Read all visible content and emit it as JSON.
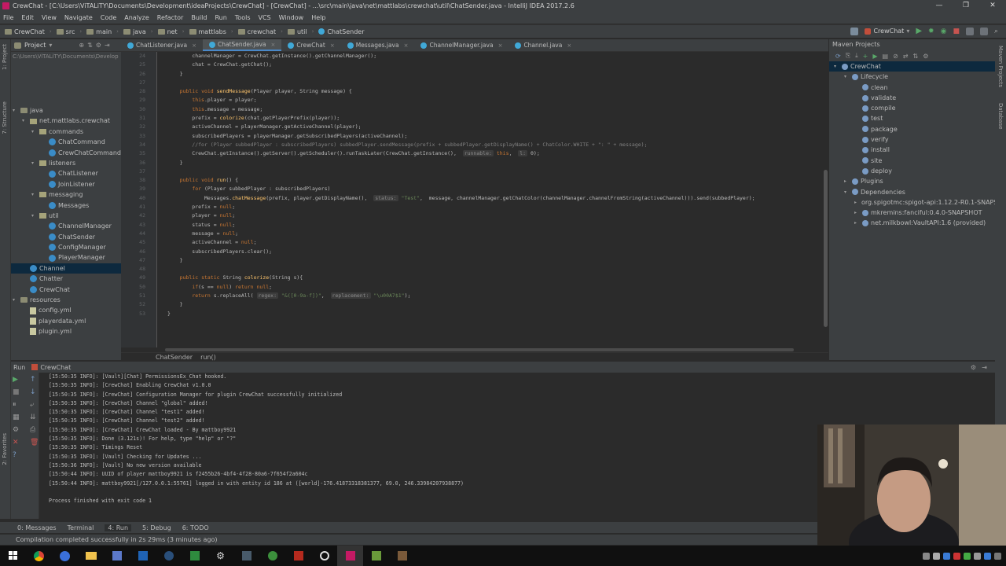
{
  "window": {
    "title": "CrewChat - [C:\\Users\\ViTALiTY\\Documents\\Development\\ideaProjects\\CrewChat] - [CrewChat] - ...\\src\\main\\java\\net\\mattlabs\\crewchat\\util\\ChatSender.java - IntelliJ IDEA 2017.2.6",
    "controls": [
      "—",
      "❐",
      "✕"
    ]
  },
  "menu": [
    "File",
    "Edit",
    "View",
    "Navigate",
    "Code",
    "Analyze",
    "Refactor",
    "Build",
    "Run",
    "Tools",
    "VCS",
    "Window",
    "Help"
  ],
  "breadcrumbs": [
    "CrewChat",
    "src",
    "main",
    "java",
    "net",
    "mattlabs",
    "crewchat",
    "util",
    "ChatSender"
  ],
  "run_config": "CrewChat",
  "project_panel": {
    "title": "Project",
    "path_hint": "C:\\Users\\ViTALiTY\\Documents\\Develop",
    "items": [
      {
        "label": "java",
        "indent": 0,
        "kind": "folder",
        "arrow": "▾"
      },
      {
        "label": "net.mattlabs.crewchat",
        "indent": 1,
        "kind": "pkg",
        "arrow": "▾"
      },
      {
        "label": "commands",
        "indent": 2,
        "kind": "pkg",
        "arrow": "▾"
      },
      {
        "label": "ChatCommand",
        "indent": 3,
        "kind": "cls",
        "arrow": ""
      },
      {
        "label": "CrewChatCommand",
        "indent": 3,
        "kind": "cls",
        "arrow": ""
      },
      {
        "label": "listeners",
        "indent": 2,
        "kind": "pkg",
        "arrow": "▾"
      },
      {
        "label": "ChatListener",
        "indent": 3,
        "kind": "cls",
        "arrow": ""
      },
      {
        "label": "JoinListener",
        "indent": 3,
        "kind": "cls",
        "arrow": ""
      },
      {
        "label": "messaging",
        "indent": 2,
        "kind": "pkg",
        "arrow": "▾"
      },
      {
        "label": "Messages",
        "indent": 3,
        "kind": "cls",
        "arrow": ""
      },
      {
        "label": "util",
        "indent": 2,
        "kind": "pkg",
        "arrow": "▾"
      },
      {
        "label": "ChannelManager",
        "indent": 3,
        "kind": "cls",
        "arrow": ""
      },
      {
        "label": "ChatSender",
        "indent": 3,
        "kind": "cls",
        "arrow": ""
      },
      {
        "label": "ConfigManager",
        "indent": 3,
        "kind": "cls",
        "arrow": ""
      },
      {
        "label": "PlayerManager",
        "indent": 3,
        "kind": "cls",
        "arrow": ""
      },
      {
        "label": "Channel",
        "indent": 1,
        "kind": "cls",
        "arrow": "",
        "selected": true
      },
      {
        "label": "Chatter",
        "indent": 1,
        "kind": "cls",
        "arrow": ""
      },
      {
        "label": "CrewChat",
        "indent": 1,
        "kind": "cls",
        "arrow": ""
      },
      {
        "label": "resources",
        "indent": 0,
        "kind": "folder",
        "arrow": "▾"
      },
      {
        "label": "config.yml",
        "indent": 1,
        "kind": "yml",
        "arrow": ""
      },
      {
        "label": "playerdata.yml",
        "indent": 1,
        "kind": "yml",
        "arrow": ""
      },
      {
        "label": "plugin.yml",
        "indent": 1,
        "kind": "yml",
        "arrow": ""
      }
    ]
  },
  "tabs": [
    {
      "label": "ChatListener.java",
      "active": false
    },
    {
      "label": "ChatSender.java",
      "active": true
    },
    {
      "label": "CrewChat",
      "active": false
    },
    {
      "label": "Messages.java",
      "active": false
    },
    {
      "label": "ChannelManager.java",
      "active": false
    },
    {
      "label": "Channel.java",
      "active": false
    }
  ],
  "gutter_lines": [
    "24",
    "25",
    "26",
    "27",
    "28",
    "29",
    "30",
    "31",
    "32",
    "33",
    "34",
    "35",
    "36",
    "37",
    "38",
    "39",
    "40",
    "41",
    "42",
    "43",
    "44",
    "45",
    "46",
    "47",
    "48",
    "49",
    "50",
    "51",
    "52",
    "53"
  ],
  "code_lines": [
    "        channelManager = CrewChat.getInstance().getChannelManager();",
    "        chat = CrewChat.getChat();",
    "    }",
    "",
    "    public void sendMessage(Player player, String message) {",
    "        this.player = player;",
    "        this.message = message;",
    "        prefix = colorize(chat.getPlayerPrefix(player));",
    "        activeChannel = playerManager.getActiveChannel(player);",
    "        subscribedPlayers = playerManager.getSubscribedPlayers(activeChannel);",
    "        //for (Player subbedPlayer : subscribedPlayers) subbedPlayer.sendMessage(prefix + subbedPlayer.getDisplayName() + ChatColor.WHITE + \": \" + message);",
    "        CrewChat.getInstance().getServer().getScheduler().runTaskLater(CrewChat.getInstance(),  runnable: this,  l: 0);",
    "    }",
    "",
    "    public void run() {",
    "        for (Player subbedPlayer : subscribedPlayers)",
    "            Messages.chatMessage(prefix, player.getDisplayName(),  status: \"Test\",  message, channelManager.getChatColor(channelManager.channelFromString(activeChannel))).send(subbedPlayer);",
    "        prefix = null;",
    "        player = null;",
    "        status = null;",
    "        message = null;",
    "        activeChannel = null;",
    "        subscribedPlayers.clear();",
    "    }",
    "",
    "    public static String colorize(String s){",
    "        if(s == null) return null;",
    "        return s.replaceAll( regex: \"&([0-9a-f])\",  replacement: \"\\u00A7$1\");",
    "    }",
    "}"
  ],
  "editor_breadcrumb": [
    "ChatSender",
    "run()"
  ],
  "maven": {
    "title": "Maven Projects",
    "items": [
      {
        "label": "CrewChat",
        "indent": 0,
        "arrow": "▾",
        "selected": true
      },
      {
        "label": "Lifecycle",
        "indent": 1,
        "arrow": "▾"
      },
      {
        "label": "clean",
        "indent": 2,
        "arrow": ""
      },
      {
        "label": "validate",
        "indent": 2,
        "arrow": ""
      },
      {
        "label": "compile",
        "indent": 2,
        "arrow": ""
      },
      {
        "label": "test",
        "indent": 2,
        "arrow": ""
      },
      {
        "label": "package",
        "indent": 2,
        "arrow": ""
      },
      {
        "label": "verify",
        "indent": 2,
        "arrow": ""
      },
      {
        "label": "install",
        "indent": 2,
        "arrow": ""
      },
      {
        "label": "site",
        "indent": 2,
        "arrow": ""
      },
      {
        "label": "deploy",
        "indent": 2,
        "arrow": ""
      },
      {
        "label": "Plugins",
        "indent": 1,
        "arrow": "▸"
      },
      {
        "label": "Dependencies",
        "indent": 1,
        "arrow": "▾"
      },
      {
        "label": "org.spigotmc:spigot-api:1.12.2-R0.1-SNAPSH",
        "indent": 2,
        "arrow": "▸"
      },
      {
        "label": "mkremins:fanciful:0.4.0-SNAPSHOT",
        "indent": 2,
        "arrow": "▸"
      },
      {
        "label": "net.milkbowl:VaultAPI:1.6 (provided)",
        "indent": 2,
        "arrow": "▸"
      }
    ]
  },
  "run_panel": {
    "label": "Run",
    "config": "CrewChat",
    "lines": [
      "[15:50:35 INFO]: [Vault][Chat] PermissionsEx_Chat hooked.",
      "[15:50:35 INFO]: [CrewChat] Enabling CrewChat v1.0.0",
      "[15:50:35 INFO]: [CrewChat] Configuration Manager for plugin CrewChat successfully initialized",
      "[15:50:35 INFO]: [CrewChat] Channel \"global\" added!",
      "[15:50:35 INFO]: [CrewChat] Channel \"test1\" added!",
      "[15:50:35 INFO]: [CrewChat] Channel \"test2\" added!",
      "[15:50:35 INFO]: [CrewChat] CrewChat loaded - By mattboy9921",
      "[15:50:35 INFO]: Done (3.121s)! For help, type \"help\" or \"?\"",
      "[15:50:35 INFO]: Timings Reset",
      "[15:50:35 INFO]: [Vault] Checking for Updates ...",
      "[15:50:36 INFO]: [Vault] No new version available",
      "[15:50:44 INFO]: UUID of player mattboy9921 is f2455b26-4bf4-4f28-80a6-7f654f2a604c",
      "[15:50:44 INFO]: mattboy9921[/127.0.0.1:55761] logged in with entity id 186 at ([world]-176.41873318381377, 69.0, 246.33984207938877)",
      "",
      "Process finished with exit code 1"
    ]
  },
  "bottom_tabs": [
    {
      "label": "0: Messages",
      "active": false
    },
    {
      "label": "Terminal",
      "active": false
    },
    {
      "label": "4: Run",
      "active": true
    },
    {
      "label": "5: Debug",
      "active": false
    },
    {
      "label": "6: TODO",
      "active": false
    }
  ],
  "status": "Compilation completed successfully in 2s 29ms (3 minutes ago)",
  "taskbar_icons": [
    "windows-start",
    "chrome",
    "firefox",
    "file-explorer",
    "calculator",
    "outlook",
    "steam",
    "spreadsheet",
    "settings",
    "media",
    "xbox",
    "filezilla",
    "overwatch",
    "intellij",
    "minecraft",
    "game"
  ]
}
